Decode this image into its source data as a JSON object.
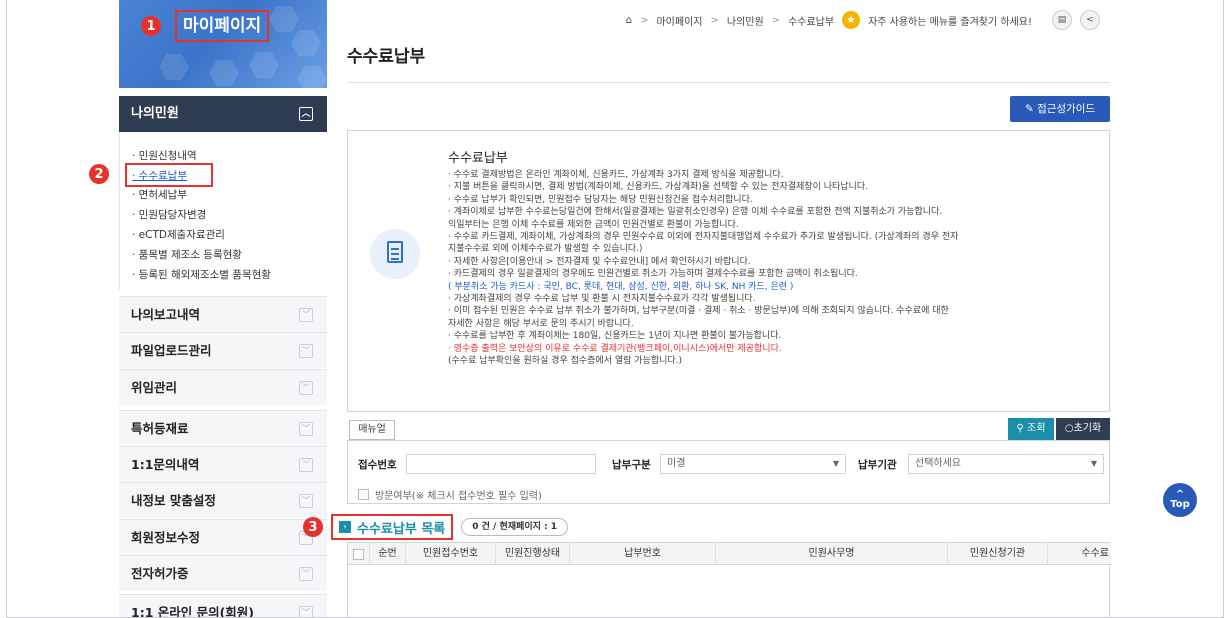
{
  "sidebar": {
    "callouts": [
      "1",
      "2",
      "3"
    ],
    "mypage_title": "마이페이지",
    "section_title": "나의민원",
    "section_toggle_icon": "collapse-icon",
    "sub_items": [
      "· 민원신청내역",
      "· 수수료납부",
      "· 면허세납부",
      "· 민원담당자변경",
      "· eCTD제출자료관리",
      "· 품목별 제조소 등록현황",
      "· 등록된 해외제조소별 품목현황"
    ],
    "menu_items": [
      "나의보고내역",
      "파일업로드관리",
      "위임관리",
      "특허등재료",
      "1:1문의내역",
      "내정보 맞춤설정",
      "회원정보수정",
      "전자허가증",
      "1:1 온라인 문의(회원)"
    ]
  },
  "breadcrumb": {
    "items": [
      "마이페이지",
      "나의민원",
      "수수료납부"
    ],
    "favorite_text": "자주 사용하는 메뉴를 즐겨찾기 하세요!"
  },
  "main": {
    "title": "수수료납부",
    "guide_button": "접근성가이드"
  },
  "notice": {
    "title": "수수료납부",
    "lines": [
      "· 수수료 결제방법은 온라인 계좌이체, 신용카드, 가상계좌 3가지 결제 방식을 제공합니다.",
      "· 지불 버튼을 클릭하시면, 결제 방법(계좌이체, 신용카드, 가상계좌)을 선택할 수 있는 전자결제창이 나타납니다.",
      "· 수수료 납부가 확인되면, 민원접수 담당자는 해당 민원신청건을 접수처리합니다.",
      "· 계좌이체로 납부한 수수료는당일건에 한해서(일괄결제는 일괄취소인경우) 은행 이체 수수료를 포함한 전액 지불취소가 가능합니다.",
      "  익일부터는 은행 이체 수수료를 제외한 금액이 민원건별로 환불이 가능합니다.",
      "· 수수료 카드결제, 계좌이체, 가상계좌의 경우 민원수수료 이외에 전자지불대행업체 수수료가 추가로 발생됩니다. (가상계좌의 경우 전자",
      "  지불수수료 외에 이체수수료가 발생할 수 있습니다.)",
      "· 자세한 사항은[이용안내 > 전자결제 및 수수료안내] 에서 확인하시기 바랍니다.",
      "· 카드결제의 경우 일괄결제의 경우에도 민원건별로 취소가 가능하며 결제수수료를 포함한 금액이 취소됩니다.",
      "  ( 부분취소 가능 카드사 : 국민, BC, 롯데, 현대, 삼성, 신한, 외환, 하나 SK, NH 카드, 은련 )",
      "· 가상계좌결제의 경우 수수료 납부 및 환불 시 전자지불수수료가 각각 발생됩니다.",
      "· 이미 접수된 민원은 수수료 납부 취소가 불가하며, 납부구분(미결 · 결제 · 취소 · 방문납부)에 의해 조회되지 않습니다. 수수료에 대한",
      "  자세한 사항은 해당 부서로 문의 주시기 바랍니다.",
      "· 수수료를 납부한 후 계좌이체는 180일, 신용카드는 1년이 지나면 환불이 불가능합니다.",
      "· 영수증 출력은 보안상의 이유로 수수료 결제기관(뱅크페이,이니시스)에서만 제공합니다.",
      "  (수수료 납부확인을 원하실 경우 접수증에서 열람 가능합니다.)"
    ]
  },
  "search": {
    "manual_button": "매뉴얼",
    "query_button": "조회",
    "reset_button": "초기화",
    "receipt_label": "접수번호",
    "receipt_value": "",
    "payment_type_label": "납부구분",
    "payment_type_value": "미결",
    "payment_org_label": "납부기관",
    "payment_org_value": "선택하세요",
    "visit_checkbox_label": "방문여부(※ 체크시 접수번호 필수 입력)"
  },
  "list": {
    "title": "수수료납부 목록",
    "count_text": "0 건 / 현재페이지 : 1",
    "columns": [
      "순번",
      "민원접수번호",
      "민원진행상태",
      "납부번호",
      "민원사무명",
      "민원신청기관",
      "수수료"
    ]
  },
  "top_button": "Top",
  "colors": {
    "accent_blue": "#2a5ab7",
    "teal": "#1b8ea8",
    "callout_red": "#e5322d",
    "nav_dark": "#2f3d52"
  }
}
